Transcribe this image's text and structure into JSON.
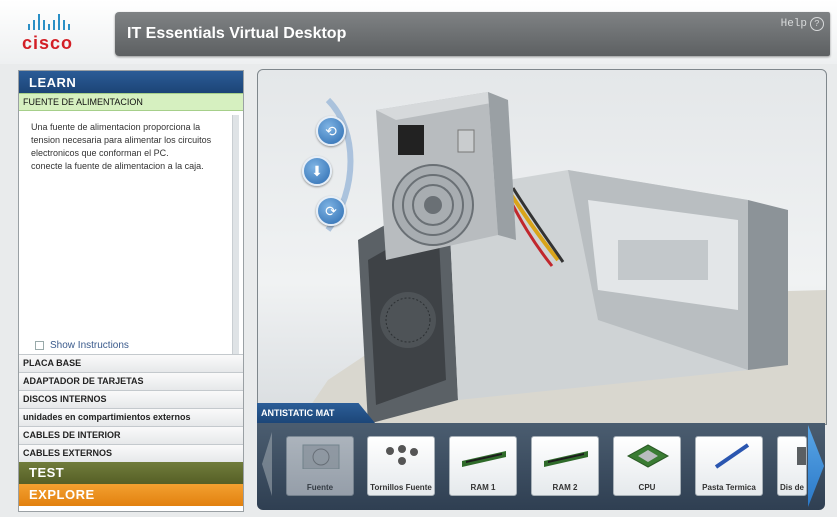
{
  "app": {
    "brand": "cisco",
    "title": "IT Essentials Virtual Desktop",
    "help_label": "Help",
    "help_icon": "question-circle-icon"
  },
  "sidebar": {
    "learn_label": "LEARN",
    "active_section": "FUENTE DE ALIMENTACION",
    "description_1": "Una fuente de alimentacion proporciona la tension necesaria para alimentar los circuitos electronicos que conforman el PC.",
    "description_2": "conecte la fuente de alimentacion a la caja.",
    "show_instructions": "Show Instructions",
    "sections": [
      "PLACA BASE",
      "ADAPTADOR DE TARJETAS",
      "DISCOS INTERNOS",
      "unidades en compartimientos externos",
      "CABLES DE INTERIOR",
      "CABLES EXTERNOS"
    ],
    "test_label": "TEST",
    "explore_label": "EXPLORE"
  },
  "viewer": {
    "controls": [
      "rotate-left-icon",
      "drop-down-icon",
      "rotate-right-icon"
    ],
    "mat_label": "ANTISTATIC MAT"
  },
  "tray": {
    "items": [
      {
        "label": "Fuente",
        "enabled": false
      },
      {
        "label": "Tornillos Fuente",
        "enabled": true
      },
      {
        "label": "RAM 1",
        "enabled": true
      },
      {
        "label": "RAM 2",
        "enabled": true
      },
      {
        "label": "CPU",
        "enabled": true
      },
      {
        "label": "Pasta Termica",
        "enabled": true
      },
      {
        "label": "Dis de",
        "enabled": true
      }
    ]
  },
  "colors": {
    "learn": "#1f4b81",
    "test": "#606b2e",
    "explore": "#ea8c1e",
    "active_section": "#d6f0c0",
    "cisco_red": "#d31f26",
    "cisco_blue": "#2a8fc6"
  }
}
